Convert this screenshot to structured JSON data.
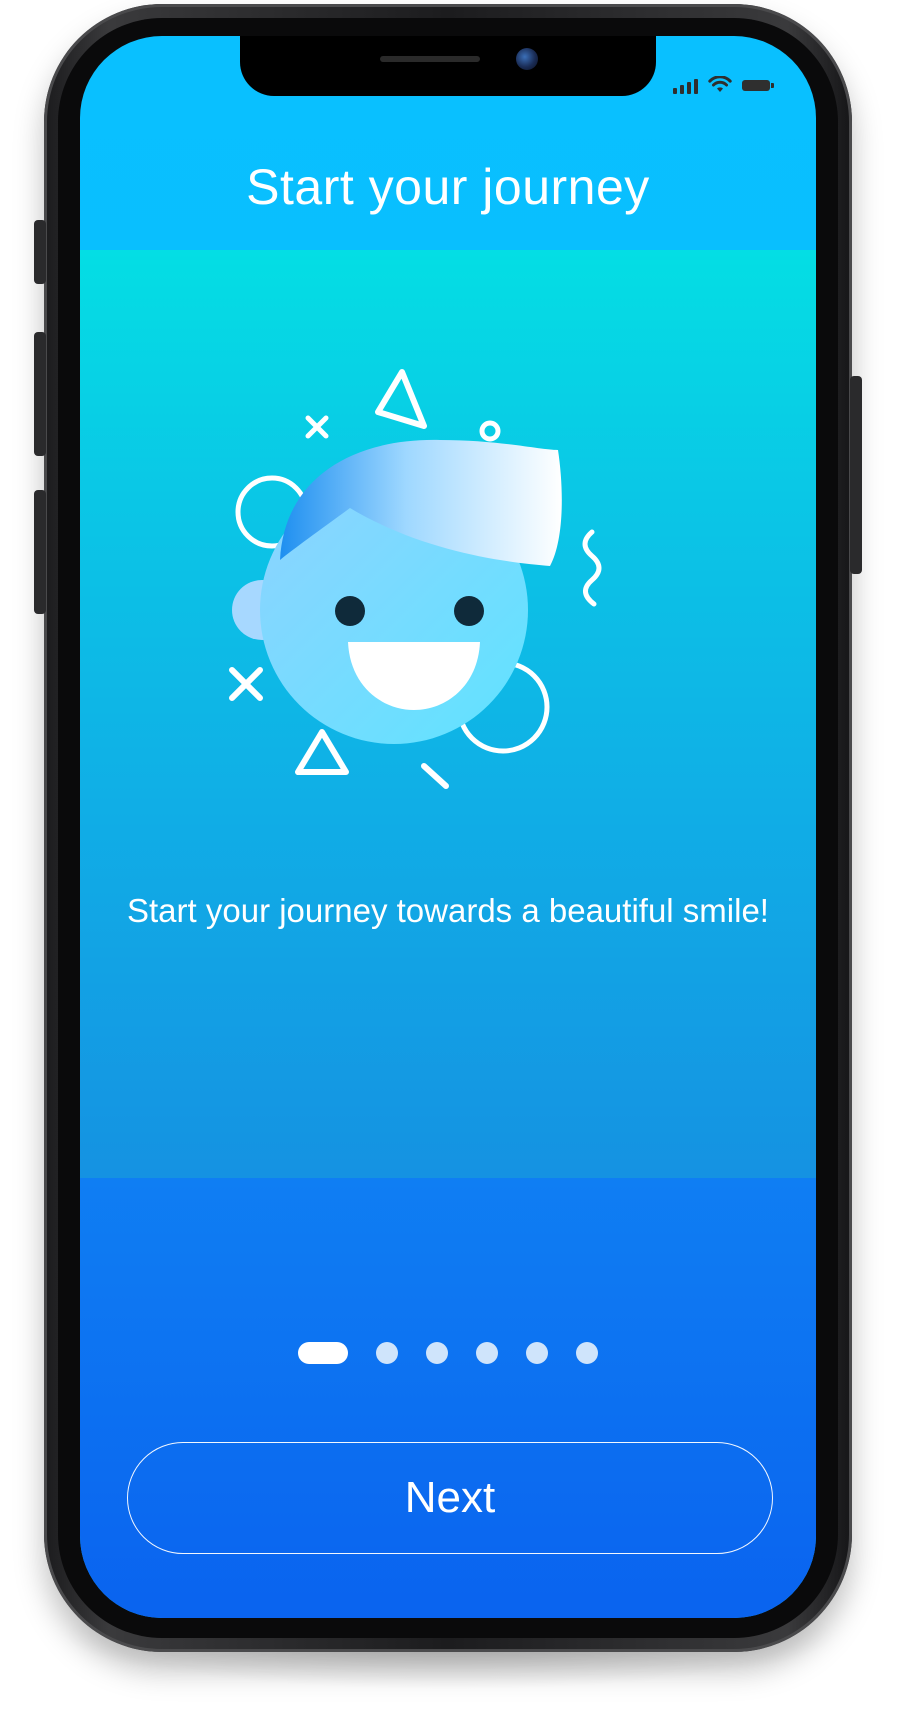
{
  "header": {
    "title": "Start your journey"
  },
  "onboarding": {
    "tagline": "Start your journey towards a beautiful smile!",
    "illustration": "smiling-face-illustration",
    "current_page": 1,
    "total_pages": 6
  },
  "footer": {
    "next_label": "Next"
  },
  "status_bar": {
    "icons": [
      "signal-icon",
      "wifi-icon",
      "battery-icon"
    ]
  },
  "colors": {
    "header_bg": "#09c0ff",
    "content_gradient_top": "#04dee4",
    "content_gradient_bottom": "#1592e2",
    "footer_bg": "#0a63ef",
    "text": "#ffffff"
  }
}
